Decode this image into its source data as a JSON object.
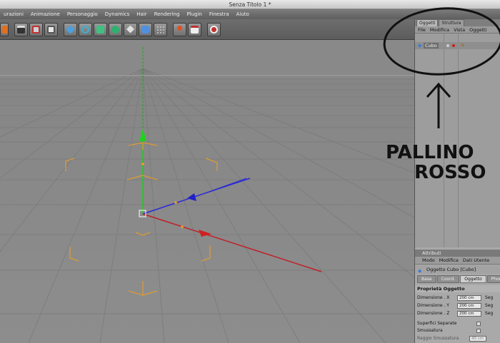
{
  "window": {
    "title": "Senza Titolo 1 *"
  },
  "menubar": {
    "items": [
      "urazioni",
      "Animazione",
      "Personaggio",
      "Dynamics",
      "Hair",
      "Rendering",
      "Plugin",
      "Finestra",
      "Aiuto"
    ]
  },
  "toolbar": {
    "icons": [
      "move-tool-icon",
      "clapboard-icon",
      "render-view-icon",
      "render-picture-icon",
      "cube-icon",
      "spline-icon",
      "nurbs-icon",
      "array-icon",
      "deformer-icon",
      "scene-icon",
      "particles-icon",
      "help-icon",
      "calendar-icon",
      "record-icon"
    ]
  },
  "object_manager": {
    "tabs": [
      "Oggetti",
      "Struttura"
    ],
    "menu": [
      "File",
      "Modifica",
      "Vista",
      "Oggetti"
    ],
    "tree": [
      {
        "name": "Cubo",
        "visibility_color": "#c82020"
      }
    ]
  },
  "attributes": {
    "header": "Attributi",
    "menu": [
      "Modo",
      "Modifica",
      "Dati Utente"
    ],
    "object_title": "Oggetto Cubo [Cubo]",
    "tabs": [
      "Base",
      "Coord.",
      "Oggetto",
      "Phong"
    ],
    "active_tab": "Oggetto",
    "section": "Proprietà Oggetto",
    "props": [
      {
        "label": "Dimensione . X",
        "value": "200 cm",
        "extra": "Seg"
      },
      {
        "label": "Dimensione . Y",
        "value": "200 cm",
        "extra": "Seg"
      },
      {
        "label": "Dimensione . Z",
        "value": "200 cm",
        "extra": "Seg"
      }
    ],
    "checks": [
      {
        "label": "Superfici Separate"
      },
      {
        "label": "Smussatura"
      }
    ],
    "smooth_radius_label": "Raggio Smussatura",
    "smooth_radius_value": "40 cm"
  },
  "annotation": {
    "line1": "PALLINO",
    "line2": "ROSSO"
  },
  "colors": {
    "axis_x": "#c0202a",
    "axis_y": "#1ec81e",
    "axis_z": "#2a2ad8",
    "bbox": "#f0a020"
  }
}
